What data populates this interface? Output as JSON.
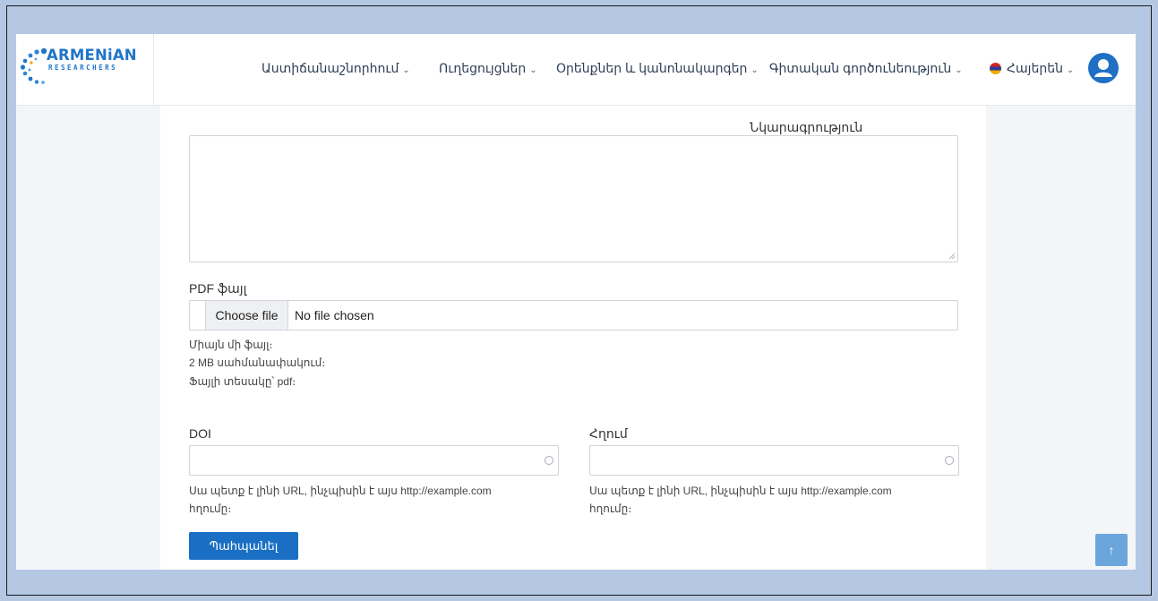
{
  "brand": {
    "name": "ARMENiAN",
    "tagline": "RESEARCHERS"
  },
  "nav": {
    "items": [
      {
        "label": "Աստիճանաշնորհում"
      },
      {
        "label": "Ուղեցույցներ"
      },
      {
        "label": "Օրենքներ և կանոնակարգեր"
      },
      {
        "label": "Գիտական գործունեություն"
      }
    ],
    "language": "Հայերեն",
    "chevron_icon": "chevron-down-icon",
    "flag_icon": "armenia-flag-icon",
    "avatar_icon": "user-avatar-icon"
  },
  "form": {
    "description_label": "Նկարագրություն",
    "description_value": "",
    "pdf_label": "PDF ֆայլ",
    "file_button": "Choose file",
    "file_status": "No file chosen",
    "pdf_hints": [
      "Միայն մի ֆայլ։",
      "2 MB սահմանափակում։",
      "Ֆայլի տեսակը՝ pdf։"
    ],
    "doi_label": "DOI",
    "doi_value": "",
    "link_label": "Հղում",
    "link_value": "",
    "url_help_line1": "Սա պետք է լինի URL, ինչպիսին է այս http://example.com",
    "url_help_line2": "հղումը։",
    "save_button": "Պահպանել"
  },
  "colors": {
    "page_background": "#b4c8e4",
    "brand_blue": "#1f75c8",
    "button_blue": "#1a6fc4",
    "scroll_top": "#6aa6dc"
  },
  "scroll_top_icon": "arrow-up-icon"
}
